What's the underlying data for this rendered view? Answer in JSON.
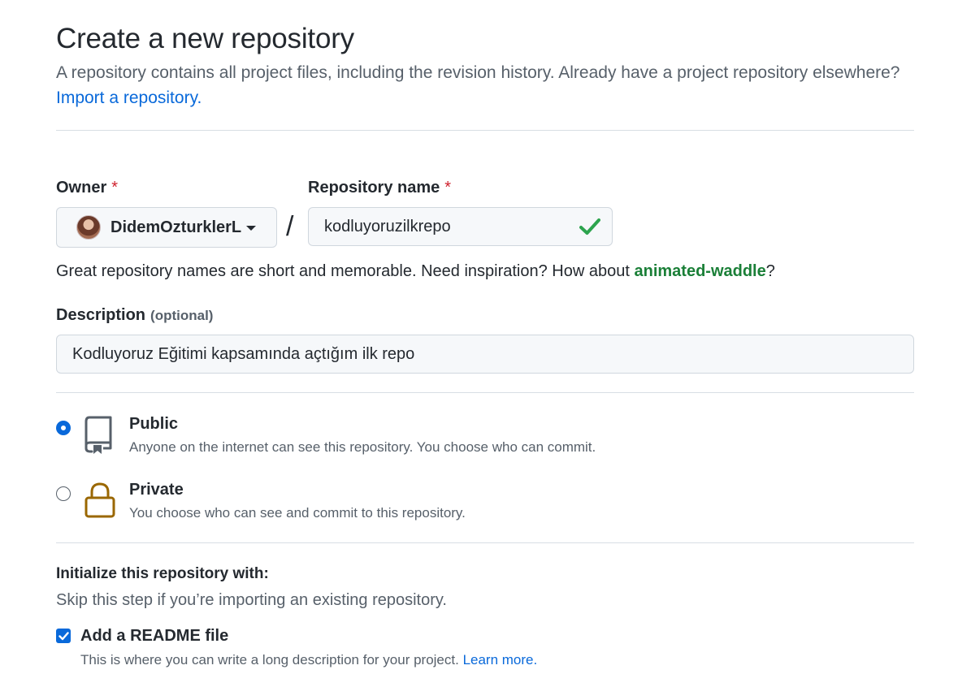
{
  "header": {
    "title": "Create a new repository",
    "subtitle": "A repository contains all project files, including the revision history. Already have a project repository elsewhere?",
    "import_link": "Import a repository."
  },
  "owner": {
    "label": "Owner",
    "required_mark": "*",
    "selected": "DidemOzturklerL"
  },
  "separator": "/",
  "repo_name": {
    "label": "Repository name",
    "required_mark": "*",
    "value": "kodluyoruzilkrepo",
    "valid": true
  },
  "name_hint": {
    "prefix": "Great repository names are short and memorable. Need inspiration? How about ",
    "suggestion": "animated-waddle",
    "suffix": "?"
  },
  "description": {
    "label": "Description",
    "optional": "(optional)",
    "value": "Kodluyoruz Eğitimi kapsamında açtığım ilk repo"
  },
  "visibility": {
    "public": {
      "title": "Public",
      "desc": "Anyone on the internet can see this repository. You choose who can commit.",
      "selected": true,
      "icon": "repo-icon"
    },
    "private": {
      "title": "Private",
      "desc": "You choose who can see and commit to this repository.",
      "selected": false,
      "icon": "lock-icon"
    }
  },
  "initialize": {
    "heading": "Initialize this repository with:",
    "subtext": "Skip this step if you’re importing an existing repository.",
    "readme": {
      "label": "Add a README file",
      "checked": true,
      "desc": "This is where you can write a long description for your project.",
      "link": "Learn more."
    }
  },
  "colors": {
    "link": "#0969da",
    "success": "#1a7f37",
    "required": "#cf222e",
    "lock": "#9a6700"
  }
}
